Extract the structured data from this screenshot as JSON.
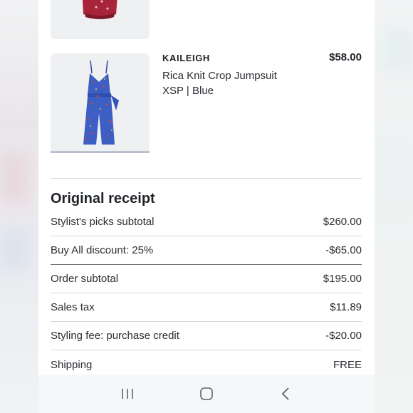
{
  "item": {
    "brand": "KAILEIGH",
    "price": "$58.00",
    "name": "Rica Knit Crop Jumpsuit",
    "variant": "XSP | Blue"
  },
  "receipt": {
    "title": "Original receipt",
    "rows": [
      {
        "label": "Stylist's picks subtotal",
        "value": "$260.00"
      },
      {
        "label": "Buy All discount: 25%",
        "value": "-$65.00"
      },
      {
        "label": "Order subtotal",
        "value": "$195.00"
      },
      {
        "label": "Sales tax",
        "value": "$11.89"
      },
      {
        "label": "Styling fee: purchase credit",
        "value": "-$20.00"
      },
      {
        "label": "Shipping",
        "value": "FREE"
      }
    ]
  },
  "navbar": {
    "icons": [
      "recent-apps-icon",
      "home-icon",
      "back-icon"
    ]
  },
  "colors": {
    "jumpsuit": "#3d5fc4",
    "prev_item": "#a8243a",
    "underline": "#2b3f6c"
  }
}
